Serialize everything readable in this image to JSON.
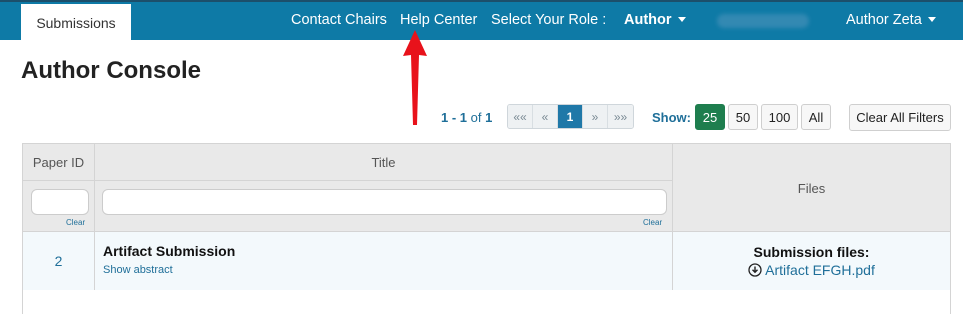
{
  "nav": {
    "active_tab": "Submissions",
    "contact_chairs": "Contact Chairs",
    "help_center": "Help Center",
    "role_label": "Select Your Role :",
    "role_value": "Author",
    "user_name": "Author Zeta"
  },
  "page_title": "Author Console",
  "pagination": {
    "range": "1 - 1",
    "of_label": "of",
    "total": "1",
    "first": "««",
    "prev": "«",
    "current": "1",
    "next": "»",
    "last": "»»"
  },
  "page_size": {
    "label": "Show:",
    "options": [
      "25",
      "50",
      "100",
      "All"
    ],
    "selected": "25"
  },
  "clear_all_filters": "Clear All Filters",
  "table": {
    "columns": {
      "paper_id": "Paper ID",
      "title": "Title",
      "files": "Files"
    },
    "clear_label": "Clear",
    "rows": [
      {
        "paper_id": "2",
        "title": "Artifact Submission",
        "show_abstract": "Show abstract",
        "files_heading": "Submission files:",
        "file_name": "Artifact EFGH.pdf"
      }
    ]
  },
  "colors": {
    "nav_bg": "#0e7aa6",
    "link": "#1f6f99",
    "page_size_active": "#1e7e4e",
    "annotation_arrow": "#e8121b"
  }
}
